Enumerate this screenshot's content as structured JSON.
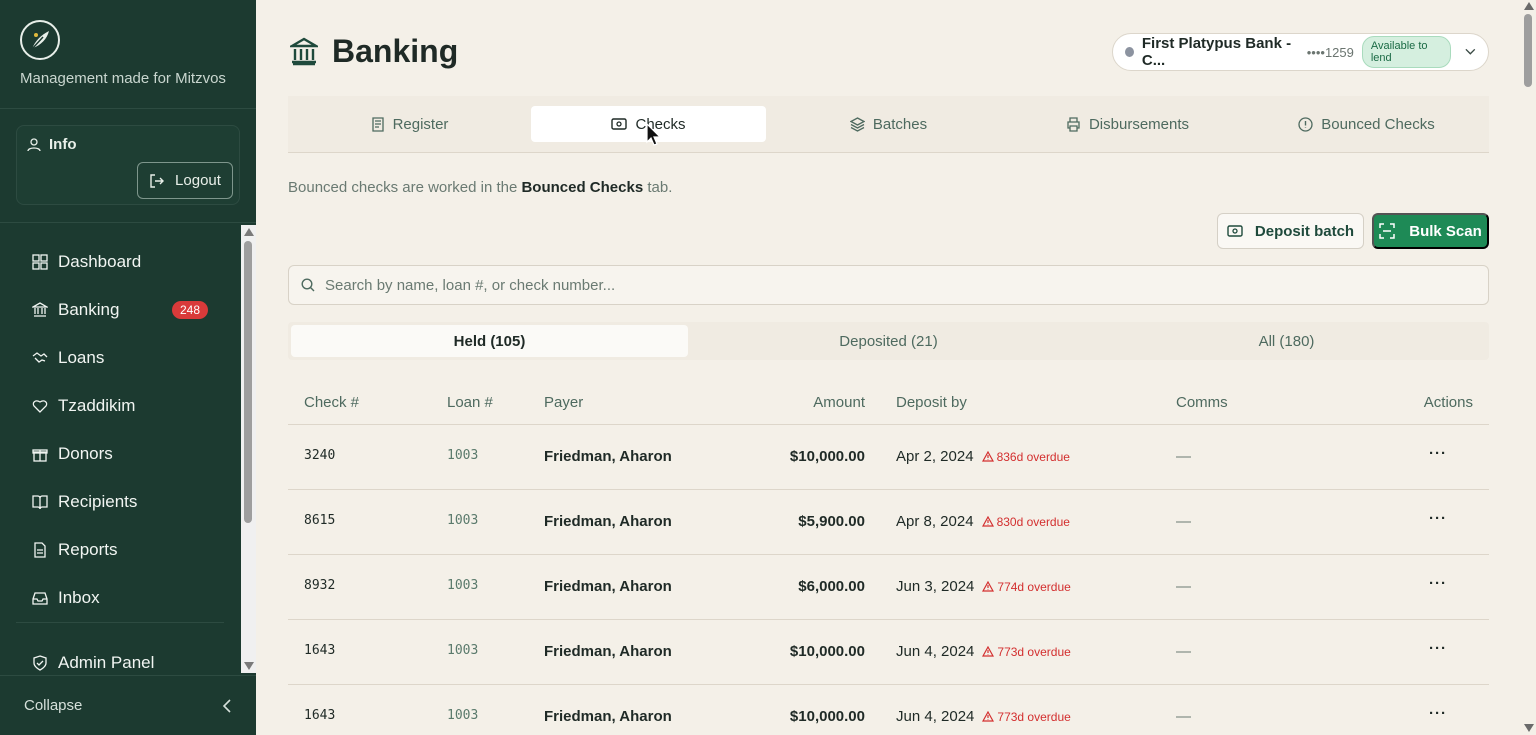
{
  "sidebar": {
    "tagline": "Management made for Mitzvos",
    "info_label": "Info",
    "logout_label": "Logout",
    "nav": [
      {
        "label": "Dashboard",
        "icon": "dashboard-icon"
      },
      {
        "label": "Banking",
        "icon": "bank-icon",
        "badge": "248"
      },
      {
        "label": "Loans",
        "icon": "handshake-icon"
      },
      {
        "label": "Tzaddikim",
        "icon": "heart-hand-icon"
      },
      {
        "label": "Donors",
        "icon": "gift-icon"
      },
      {
        "label": "Recipients",
        "icon": "book-icon"
      },
      {
        "label": "Reports",
        "icon": "document-icon"
      },
      {
        "label": "Inbox",
        "icon": "inbox-icon"
      }
    ],
    "admin_label": "Admin Panel",
    "collapse_label": "Collapse"
  },
  "header": {
    "title": "Banking",
    "account": {
      "name": "First Platypus Bank - C...",
      "mask": "••••1259",
      "status": "Available to lend"
    }
  },
  "tabs": [
    {
      "label": "Register",
      "icon": "register-icon"
    },
    {
      "label": "Checks",
      "icon": "check-icon",
      "active": true
    },
    {
      "label": "Batches",
      "icon": "layers-icon"
    },
    {
      "label": "Disbursements",
      "icon": "printer-icon"
    },
    {
      "label": "Bounced Checks",
      "icon": "alert-circle-icon"
    }
  ],
  "note": {
    "prefix": "Bounced checks are worked in the ",
    "bold": "Bounced Checks",
    "suffix": " tab."
  },
  "actions": {
    "deposit_label": "Deposit batch",
    "scan_label": "Bulk Scan"
  },
  "search": {
    "placeholder": "Search by name, loan #, or check number..."
  },
  "subtabs": [
    {
      "label": "Held (105)",
      "active": true
    },
    {
      "label": "Deposited (21)"
    },
    {
      "label": "All (180)"
    }
  ],
  "table": {
    "columns": [
      "Check #",
      "Loan #",
      "Payer",
      "Amount",
      "Deposit by",
      "Comms",
      "Actions"
    ],
    "rows": [
      {
        "check": "3240",
        "loan": "1003",
        "payer": "Friedman, Aharon",
        "amount": "$10,000.00",
        "date": "Apr 2, 2024",
        "overdue": "836d overdue",
        "comms": "—",
        "actions": "···"
      },
      {
        "check": "8615",
        "loan": "1003",
        "payer": "Friedman, Aharon",
        "amount": "$5,900.00",
        "date": "Apr 8, 2024",
        "overdue": "830d overdue",
        "comms": "—",
        "actions": "···"
      },
      {
        "check": "8932",
        "loan": "1003",
        "payer": "Friedman, Aharon",
        "amount": "$6,000.00",
        "date": "Jun 3, 2024",
        "overdue": "774d overdue",
        "comms": "—",
        "actions": "···"
      },
      {
        "check": "1643",
        "loan": "1003",
        "payer": "Friedman, Aharon",
        "amount": "$10,000.00",
        "date": "Jun 4, 2024",
        "overdue": "773d overdue",
        "comms": "—",
        "actions": "···"
      },
      {
        "check": "1643",
        "loan": "1003",
        "payer": "Friedman, Aharon",
        "amount": "$10,000.00",
        "date": "Jun 4, 2024",
        "overdue": "773d overdue",
        "comms": "—",
        "actions": "···"
      }
    ]
  },
  "colors": {
    "sidebar_bg": "#1c3a30",
    "accent_green": "#1e8a56",
    "badge_red": "#d93a3a",
    "overdue_red": "#d32f2f",
    "page_bg": "#f4f0e8"
  }
}
